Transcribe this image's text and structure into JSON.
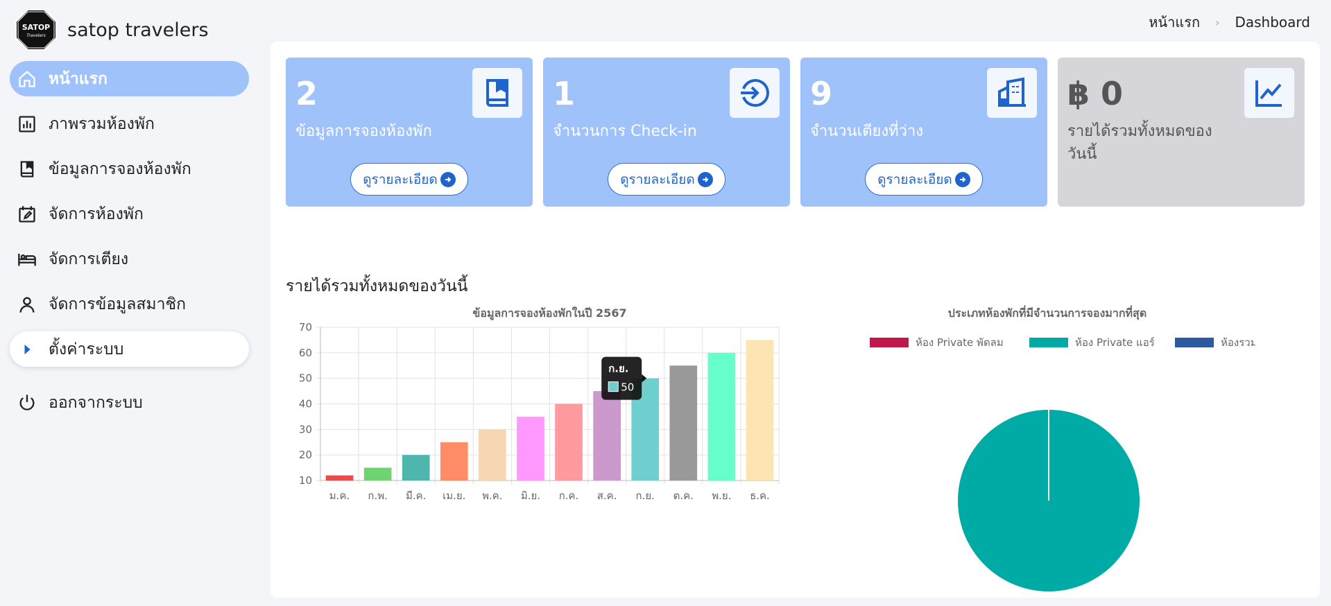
{
  "brand": {
    "name": "satop travelers",
    "logo_text": "SATOP",
    "logo_sub": "Travelers"
  },
  "sidebar": {
    "items": [
      {
        "label": "หน้าแรก",
        "icon": "home-icon",
        "active": true
      },
      {
        "label": "ภาพรวมห้องพัก",
        "icon": "bar-chart-icon"
      },
      {
        "label": "ข้อมูลการจองห้องพัก",
        "icon": "book-icon"
      },
      {
        "label": "จัดการห้องพัก",
        "icon": "calendar-edit-icon"
      },
      {
        "label": "จัดการเตียง",
        "icon": "bed-icon"
      },
      {
        "label": "จัดการข้อมูลสมาชิก",
        "icon": "user-icon"
      },
      {
        "label": "ตั้งค่าระบบ",
        "icon": "caret-right-icon"
      },
      {
        "label": "ออกจากระบบ",
        "icon": "power-icon"
      }
    ]
  },
  "breadcrumb": {
    "home": "หน้าแรก",
    "current": "Dashboard"
  },
  "cards": [
    {
      "value": "2",
      "label": "ข้อมูลการจองห้องพัก",
      "button": "ดูรายละเอียด",
      "icon": "book-icon"
    },
    {
      "value": "1",
      "label": "จำนวนการ Check-in",
      "button": "ดูรายละเอียด",
      "icon": "sign-in-icon"
    },
    {
      "value": "9",
      "label": "จำนวนเตียงที่ว่าง",
      "button": "ดูรายละเอียด",
      "icon": "building-icon"
    },
    {
      "value": "฿ 0",
      "label": "รายได้รวมทั้งหมดของวันนี้",
      "icon": "line-chart-icon"
    }
  ],
  "section_title": "รายได้รวมทั้งหมดของวันนี้",
  "colors": {
    "accent": "#9fc2fb",
    "primary": "#1f63cc",
    "card_gray": "#d6d6da"
  },
  "chart_data": [
    {
      "type": "bar",
      "title": "ข้อมูลการจองห้องพักในปี 2567",
      "categories": [
        "ม.ค.",
        "ก.พ.",
        "มี.ค.",
        "เม.ย.",
        "พ.ค.",
        "มิ.ย.",
        "ก.ค.",
        "ส.ค.",
        "ก.ย.",
        "ต.ค.",
        "พ.ย.",
        "ธ.ค."
      ],
      "values": [
        12,
        15,
        20,
        25,
        30,
        35,
        40,
        45,
        50,
        55,
        60,
        65
      ],
      "colors": [
        "#e84c4c",
        "#6fd46f",
        "#4fb6ad",
        "#ff8c66",
        "#f6d6b3",
        "#ff99ff",
        "#ff9a9e",
        "#cc99cc",
        "#6fcfcf",
        "#999999",
        "#66ffcc",
        "#fde4b3"
      ],
      "ylim": [
        10,
        70
      ],
      "yticks": [
        10,
        20,
        30,
        40,
        50,
        60,
        70
      ],
      "grid": true,
      "tooltip": {
        "category": "ก.ย.",
        "value": "50"
      }
    },
    {
      "type": "pie",
      "title": "ประเภทห้องพักที่มีจำนวนการจองมากที่สุด",
      "legend_position": "top",
      "series": [
        {
          "name": "ห้อง Private พัดลม",
          "value": 0,
          "color": "#c0184a"
        },
        {
          "name": "ห้อง Private แอร์",
          "value": 100,
          "color": "#00aba5"
        },
        {
          "name": "ห้องรวม",
          "value": 0,
          "color": "#2b5aa0"
        }
      ]
    }
  ]
}
